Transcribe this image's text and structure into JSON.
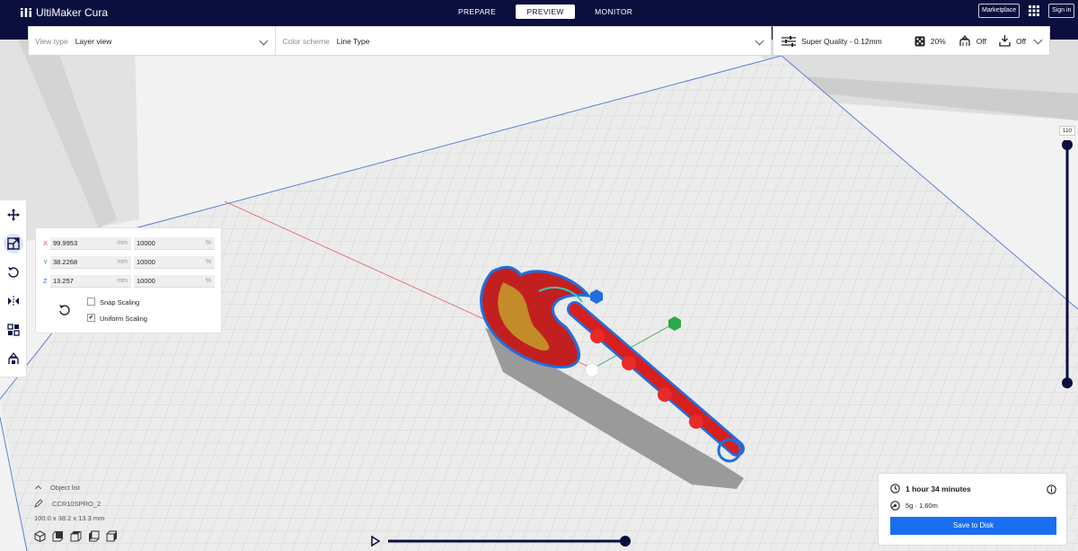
{
  "app": {
    "title": "UltiMaker Cura"
  },
  "stages": [
    {
      "label": "PREPARE"
    },
    {
      "label": "PREVIEW"
    },
    {
      "label": "MONITOR"
    }
  ],
  "top_right": {
    "marketplace": "Marketplace",
    "signin": "Sign in"
  },
  "viewbar": {
    "view_type_label": "View type",
    "view_type_value": "Layer view",
    "color_scheme_label": "Color scheme",
    "color_scheme_value": "Line Type"
  },
  "print_settings": {
    "profile": "Super Quality - 0.12mm",
    "infill": "20%",
    "support": "Off",
    "adhesion": "Off"
  },
  "scale_tool": {
    "x": {
      "axis": "X",
      "mm": "99.9953",
      "mm_unit": "mm",
      "pct": "10000",
      "pct_unit": "%"
    },
    "y": {
      "axis": "Y",
      "mm": "38.2268",
      "mm_unit": "mm",
      "pct": "10000",
      "pct_unit": "%"
    },
    "z": {
      "axis": "Z",
      "mm": "13.257",
      "mm_unit": "mm",
      "pct": "10000",
      "pct_unit": "%"
    },
    "snap_scaling": "Snap Scaling",
    "uniform_scaling": "Uniform Scaling",
    "uniform_checked_mark": "✔"
  },
  "layer_slider": {
    "value": "110"
  },
  "object_list": {
    "title": "Object list",
    "printer": "CCR10SPRO_2",
    "dimensions": "100.0 x 38.2 x 13.3 mm"
  },
  "print_info": {
    "time": "1 hour 34 minutes",
    "material": "5g · 1.60m",
    "save_button": "Save to Disk"
  },
  "colors": {
    "header": "#0b0f3d",
    "accent": "#196ef0",
    "slider": "#0b0f3d"
  }
}
